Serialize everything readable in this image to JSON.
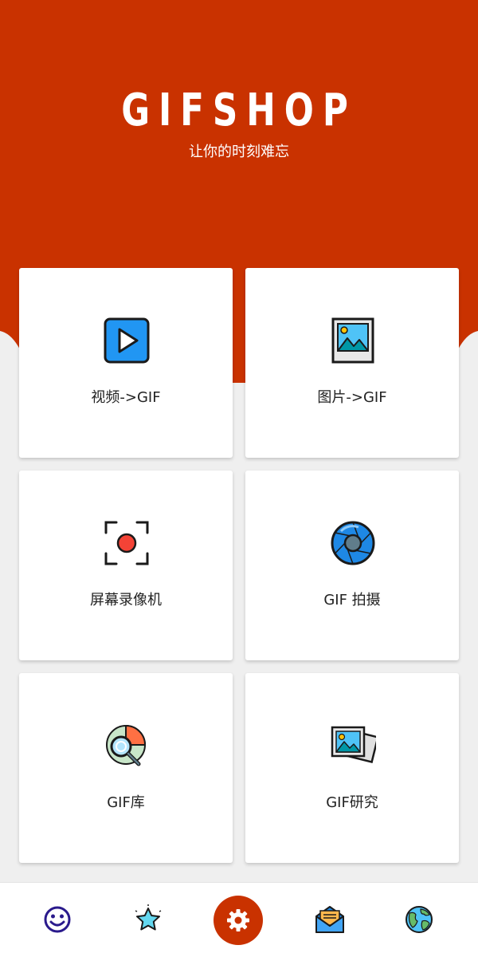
{
  "app": {
    "brand": "GIFSHOP",
    "tagline": "让你的时刻难忘"
  },
  "colors": {
    "header": "#c93200",
    "background": "#efefef",
    "card": "#ffffff"
  },
  "cards": [
    {
      "label": "视频->GIF",
      "icon": "video-play-icon"
    },
    {
      "label": "图片->GIF",
      "icon": "picture-icon"
    },
    {
      "label": "屏幕录像机",
      "icon": "screen-record-icon"
    },
    {
      "label": "GIF 拍摄",
      "icon": "camera-shutter-icon"
    },
    {
      "label": "GIF库",
      "icon": "library-search-icon"
    },
    {
      "label": "GIF研究",
      "icon": "photos-stack-icon"
    }
  ],
  "bottom_nav": [
    {
      "icon": "smiley-icon"
    },
    {
      "icon": "star-icon"
    },
    {
      "icon": "settings-gear-icon"
    },
    {
      "icon": "mail-icon"
    },
    {
      "icon": "globe-icon"
    }
  ]
}
